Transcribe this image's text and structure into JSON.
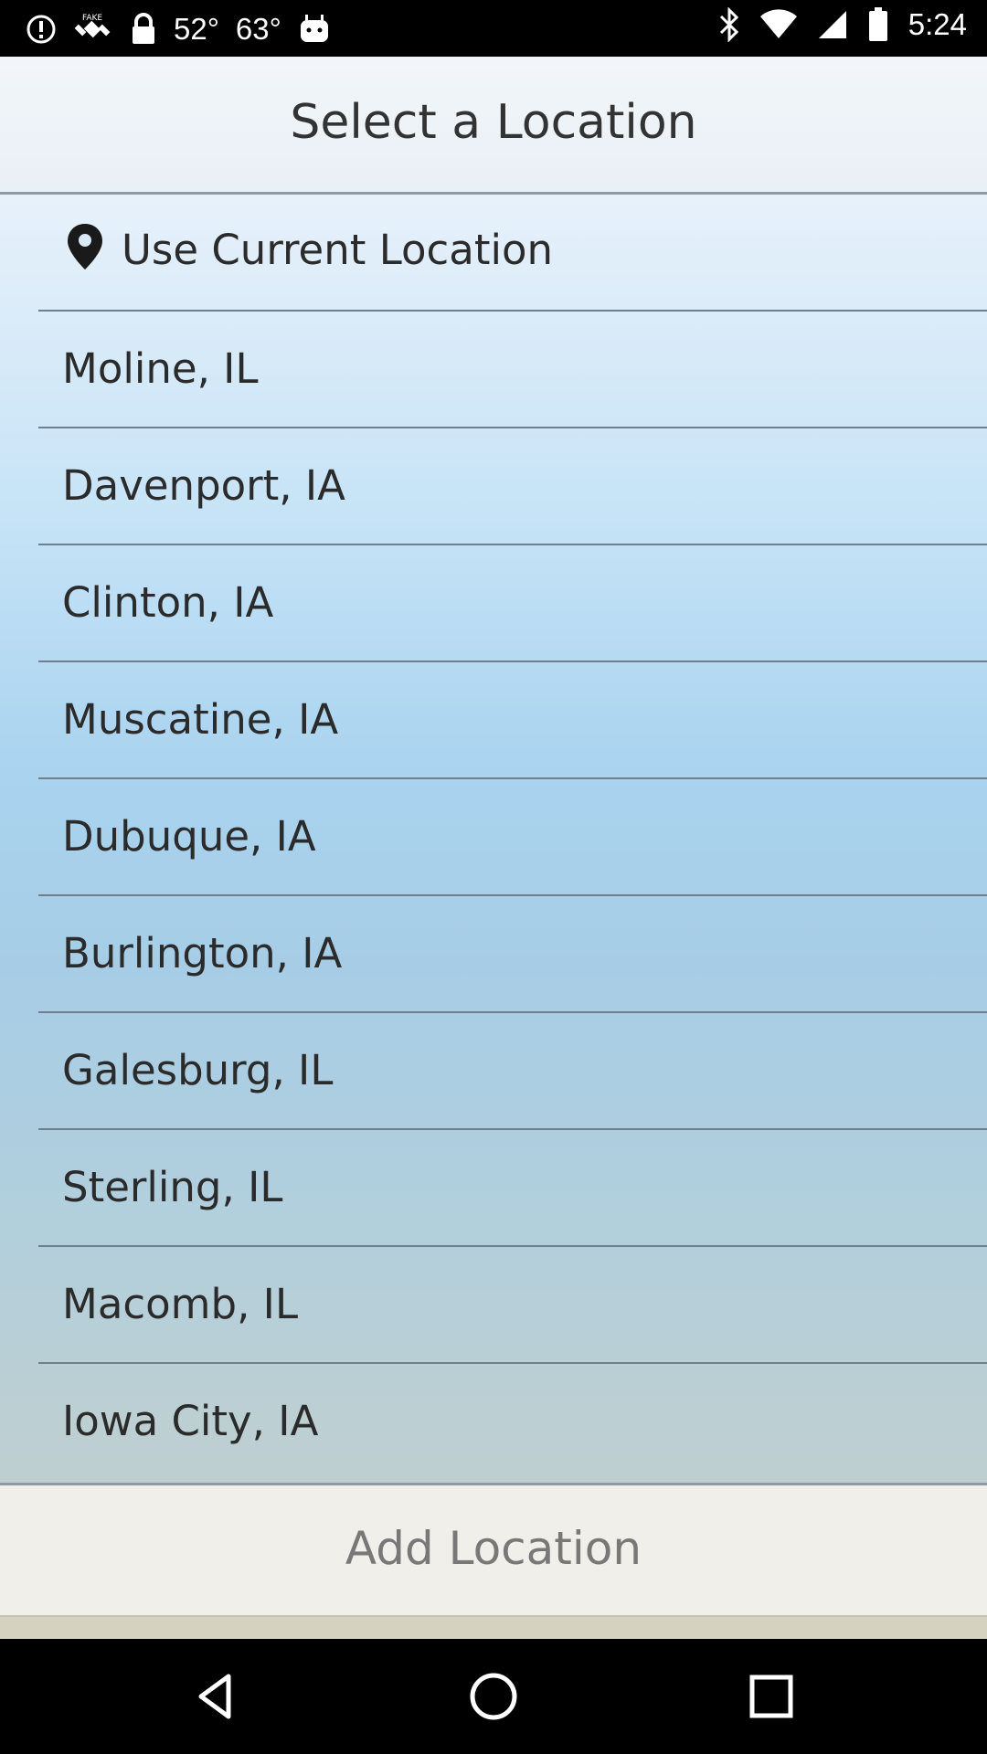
{
  "status_bar": {
    "temp1": "52°",
    "temp2": "63°",
    "time": "5:24",
    "icons": [
      "alert-circle-icon",
      "fake-gps-icon",
      "lock-icon",
      "android-icon",
      "bluetooth-icon",
      "wifi-icon",
      "signal-icon",
      "battery-icon"
    ]
  },
  "header": {
    "title": "Select a Location"
  },
  "current_location": {
    "label": "Use Current Location",
    "icon": "location-pin-icon"
  },
  "locations": [
    "Moline, IL",
    "Davenport, IA",
    "Clinton, IA",
    "Muscatine, IA",
    "Dubuque, IA",
    "Burlington, IA",
    "Galesburg, IL",
    "Sterling, IL",
    "Macomb, IL",
    "Iowa City, IA"
  ],
  "footer": {
    "add_label": "Add Location"
  },
  "nav": {
    "icons": [
      "back-icon",
      "home-icon",
      "recents-icon"
    ]
  }
}
